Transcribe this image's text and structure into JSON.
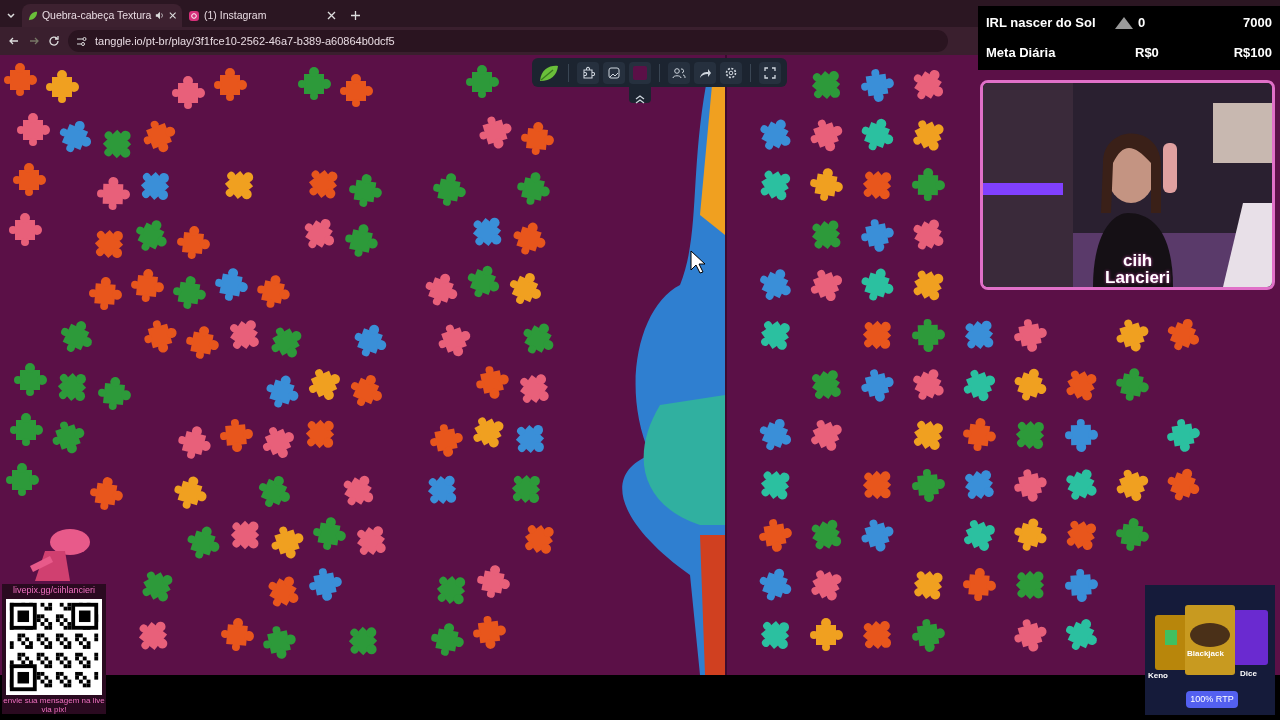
{
  "browser": {
    "tabs": [
      {
        "title": "Quebra-cabeça Textura",
        "selected": true,
        "audio": true
      },
      {
        "title": "(1) Instagram",
        "selected": false,
        "audio": false
      }
    ],
    "url": "tanggle.io/pt-br/play/3f1fce10-2562-46a7-b389-a60864b0dcf5"
  },
  "goals": [
    {
      "kind": "xp",
      "label": "IRL nascer do Sol",
      "current": "0",
      "target": "7000"
    },
    {
      "kind": "money",
      "label": "Meta Diária",
      "current": "R$0",
      "target": "R$100"
    }
  ],
  "webcam": {
    "name_lines": [
      "ciih",
      "Lancieri"
    ]
  },
  "pix": {
    "link": "livepix.gg/ciihlancieri",
    "caption": "envie sua mensagem na live via pix!"
  },
  "ad": {
    "games": [
      "Keno",
      "Blackjack",
      "Dice"
    ],
    "button": "100% RTP"
  }
}
